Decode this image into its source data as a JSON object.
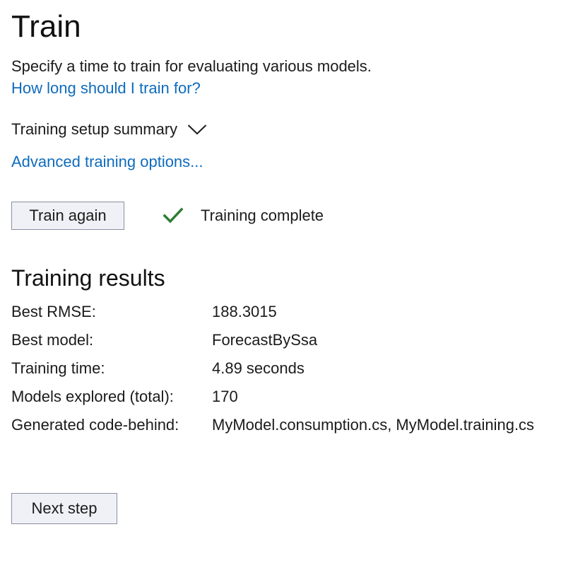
{
  "header": {
    "title": "Train",
    "subtitle": "Specify a time to train for evaluating various models.",
    "help_link": "How long should I train for?"
  },
  "setup_summary": {
    "label": "Training setup summary",
    "icon": "chevron-down-icon"
  },
  "advanced_link": "Advanced training options...",
  "actions": {
    "train_again_label": "Train again",
    "status_text": "Training complete",
    "status_icon": "checkmark-icon",
    "status_color": "#2e7d32"
  },
  "results": {
    "title": "Training results",
    "rows": [
      {
        "label": "Best RMSE:",
        "value": "188.3015"
      },
      {
        "label": "Best model:",
        "value": "ForecastBySsa"
      },
      {
        "label": "Training time:",
        "value": "4.89 seconds"
      },
      {
        "label": "Models explored (total):",
        "value": "170"
      },
      {
        "label": "Generated code-behind:",
        "value": "MyModel.consumption.cs, MyModel.training.cs"
      }
    ]
  },
  "footer": {
    "next_step_label": "Next step"
  },
  "colors": {
    "link": "#0f6cbd",
    "button_background": "#f0f1f6",
    "button_border": "#8a8fa3",
    "success": "#2e7d32"
  }
}
